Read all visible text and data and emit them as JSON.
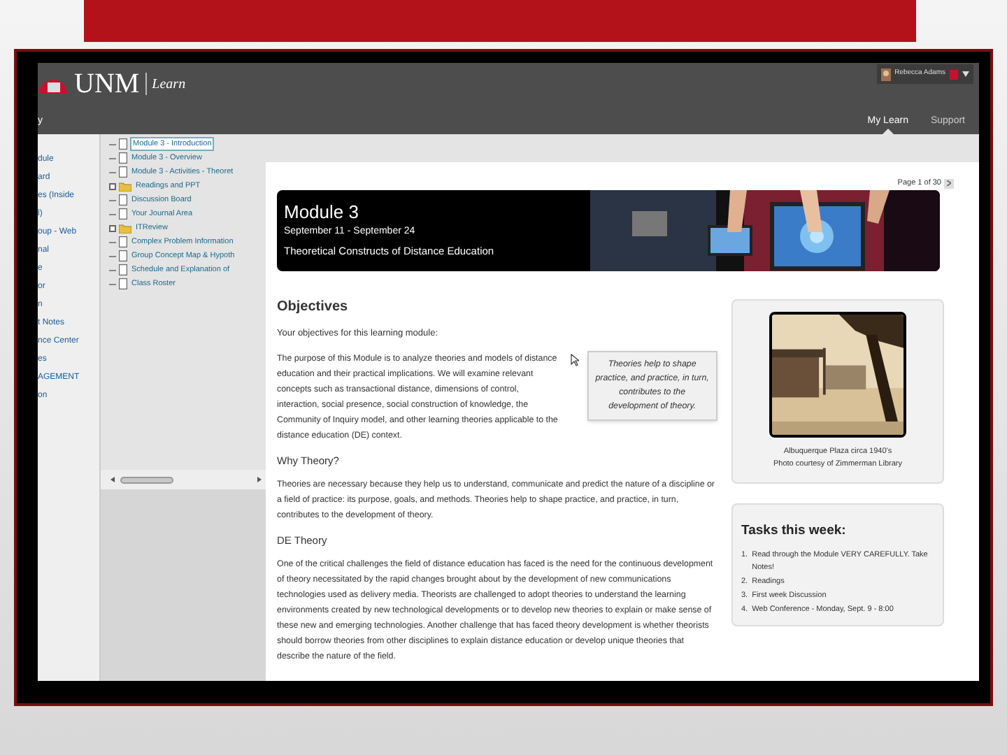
{
  "header": {
    "logo": "UNM",
    "app": "Learn",
    "user": "Rebecca Adams",
    "breadcrumb": "y",
    "nav": [
      {
        "label": "My Learn",
        "selected": true
      },
      {
        "label": "Support",
        "selected": false
      }
    ]
  },
  "course_menu": {
    "items": [
      "dule",
      "ard",
      "es (Inside",
      "l)",
      "oup - Web",
      "nal",
      "e",
      "or",
      "n",
      "t Notes",
      "nce Center",
      "es",
      "AGEMENT",
      "on"
    ]
  },
  "content_tree": {
    "items": [
      {
        "label": "Module 3 - Introduction",
        "kind": "page",
        "selected": true
      },
      {
        "label": "Module 3 - Overview",
        "kind": "page",
        "selected": false
      },
      {
        "label": "Module 3 - Activities - Theoret",
        "kind": "page",
        "selected": false
      },
      {
        "label": "Readings and PPT",
        "kind": "folder",
        "selected": false
      },
      {
        "label": "Discussion Board",
        "kind": "page",
        "selected": false
      },
      {
        "label": "Your Journal Area",
        "kind": "page",
        "selected": false
      },
      {
        "label": "ITReview",
        "kind": "folder",
        "selected": false
      },
      {
        "label": "Complex Problem Information",
        "kind": "page",
        "selected": false
      },
      {
        "label": "Group Concept Map & Hypoth",
        "kind": "page",
        "selected": false
      },
      {
        "label": "Schedule and Explanation of",
        "kind": "page",
        "selected": false
      },
      {
        "label": "Class Roster",
        "kind": "page",
        "selected": false
      }
    ]
  },
  "content": {
    "pager": "Page 1 of 30",
    "banner": {
      "title": "Module 3",
      "dates": "September 11 - September 24",
      "subtitle": "Theoretical Constructs of Distance Education"
    },
    "heading": "Objectives",
    "intro": "Your objectives for this learning module:",
    "paragraph": "The purpose of this Module is to analyze theories and models of distance education and their practical implications. We will examine relevant concepts such as transactional distance, dimensions of control, interaction, social presence, social construction of knowledge, the Community of Inquiry model, and other learning theories applicable to the distance education (DE) context.",
    "callout": "Theories help to shape practice, and practice, in turn, contributes to the development of theory.",
    "sections": [
      {
        "heading": "Why Theory?",
        "text": "Theories are necessary because they help us to understand, communicate and predict the nature of a discipline or a field of practice: its purpose, goals, and methods. Theories help to shape practice, and practice, in turn, contributes to the development of theory."
      },
      {
        "heading": "DE Theory",
        "text": "One of the critical challenges the field of distance education has faced is the need for the continuous development of theory necessitated by the rapid changes brought about by the development of new communications technologies used as delivery media. Theorists are challenged to adopt theories to understand the learning environments created by new technological developments or to develop new theories to explain or make sense of these new and emerging technologies. Another challenge that has faced theory development is whether theorists should borrow theories from other disciplines to explain distance education or develop unique theories that describe the nature of the field."
      }
    ],
    "photo": {
      "caption": [
        "Albuquerque Plaza circa 1940's",
        "Photo courtesy of Zimmerman Library"
      ]
    },
    "tasks": {
      "title": "Tasks this week:",
      "items": [
        {
          "number": "1.",
          "text": "Read through the Module VERY CAREFULLY. Take Notes!"
        },
        {
          "number": "2.",
          "text": "Readings"
        },
        {
          "number": "3.",
          "text": "First week Discussion"
        },
        {
          "number": "4.",
          "text": "Web Conference - Monday, Sept. 9 - 8:00"
        }
      ]
    }
  }
}
